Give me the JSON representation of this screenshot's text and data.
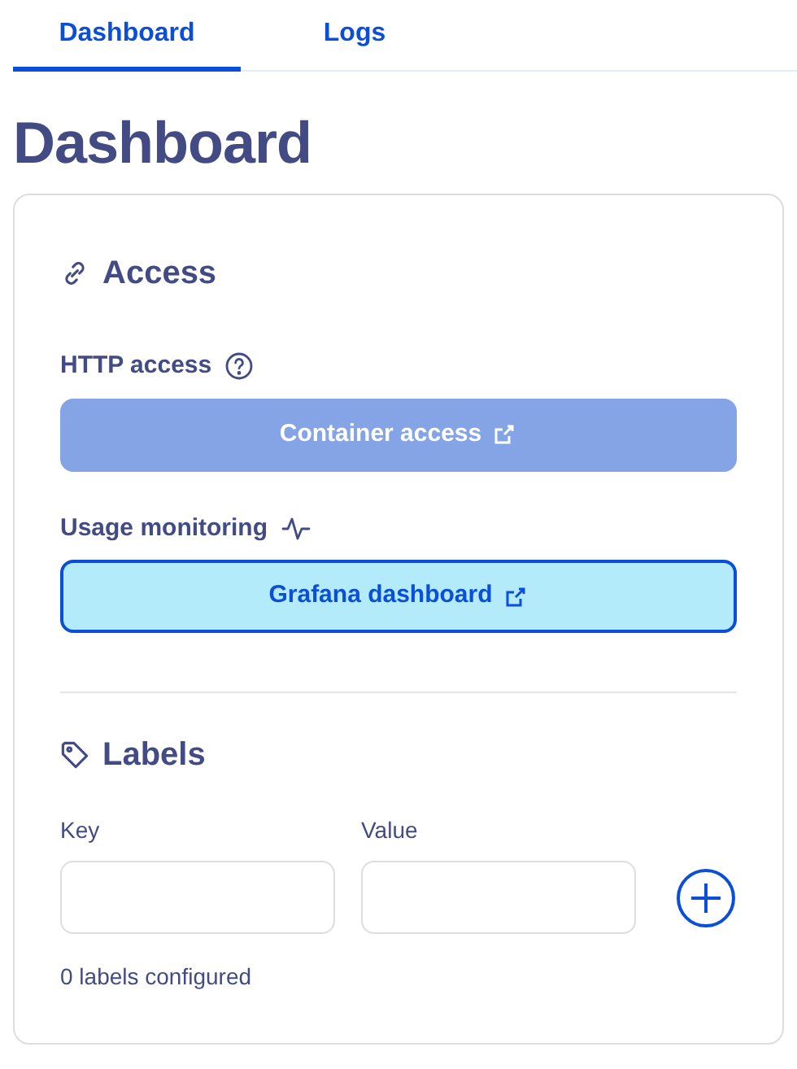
{
  "tabs": [
    {
      "label": "Dashboard",
      "selected": true
    },
    {
      "label": "Logs",
      "selected": false
    }
  ],
  "title": "Dashboard",
  "access": {
    "heading": "Access",
    "groups": [
      {
        "label": "HTTP access",
        "button": {
          "label": "Container access",
          "disabled": true
        }
      },
      {
        "label": "Usage monitoring",
        "button": {
          "label": "Grafana dashboard",
          "disabled": false
        }
      }
    ]
  },
  "labels": {
    "heading": "Labels",
    "fields": [
      {
        "label": "Key"
      },
      {
        "label": "Value"
      }
    ],
    "count": "0 labels configured"
  }
}
